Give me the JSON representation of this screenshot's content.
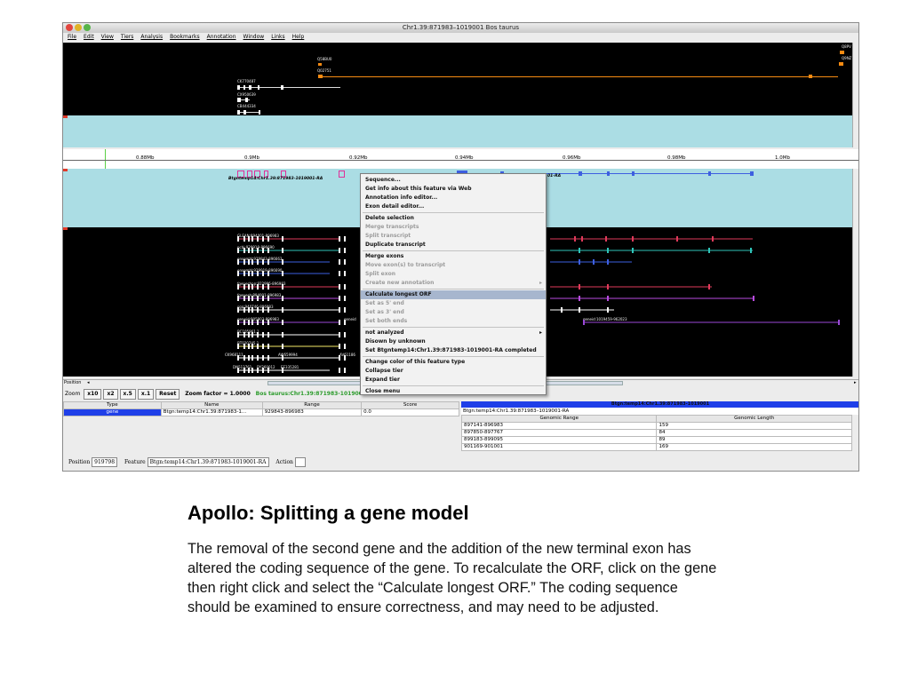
{
  "window": {
    "title": "Chr1.39:871983–1019001 Bos taurus",
    "menu": [
      "File",
      "Edit",
      "View",
      "Tiers",
      "Analysis",
      "Bookmarks",
      "Annotation",
      "Window",
      "Links",
      "Help"
    ],
    "traffic_light_colors": [
      "#e2463f",
      "#e0b327",
      "#56b448"
    ]
  },
  "overview": {
    "labels": [
      "Q58BU0",
      "Q02751",
      "CK770487",
      "CX950639",
      "CB444334",
      "Q8PV",
      "Q9NZ"
    ]
  },
  "ruler": {
    "ticks": [
      "0.88Mb",
      "0.9Mb",
      "0.92Mb",
      "0.94Mb",
      "0.96Mb",
      "0.98Mb",
      "1.0Mb"
    ]
  },
  "annotation": {
    "gene_label": "Btgntemp14:Chr1.39:871983-1019001-RA",
    "label_right": "01-RA"
  },
  "evidence": {
    "labels": [
      "GLEAN:894001-896983",
      "ncbi:929919-896690",
      "ensembl:929843-896663",
      "ensembl:929919-896690",
      "fgeneshpp:922996-896983",
      "fgenesh:894001-896983",
      "sgp:940746-896983",
      "geneid:905903-896983",
      "geneid",
      "BC105961.1",
      "BT020745.1",
      "CK968111",
      "AW659994",
      "AV61186",
      "DN513761",
      "DY260012",
      "EE335281"
    ],
    "geneid_right": "geneid:1019459-962023"
  },
  "colors": {
    "track_blue": "#3d5fe0",
    "track_red": "#e03a5a",
    "track_teal": "#2fc4b9",
    "track_violet": "#b84be0",
    "track_purple": "#9a49d6",
    "track_white": "#ffffff",
    "track_yellow": "#f3ea69",
    "orange": "#f78b12",
    "selection_blue": "#1f3fe8",
    "menu_highlight": "#a7b6ce"
  },
  "position_label": "Position",
  "zoom": {
    "label": "Zoom",
    "buttons": [
      "x10",
      "x2",
      "x.5",
      "x.1",
      "Reset"
    ],
    "factor": "Zoom factor = 1.0000",
    "region": "Bos taurus:Chr1.39:871983-101900"
  },
  "left_table": {
    "headers": [
      "Type",
      "Name",
      "Range",
      "Score"
    ],
    "row": [
      "gene",
      "Btgn:temp14:Chr1.39:871983-1...",
      "929843-896983",
      "0.0"
    ]
  },
  "right_table": {
    "title": "Btgn:temp14:Chr1.39:871983-1019001",
    "subtitle": "Btgn:temp14:Chr1.39:871983–1019001-RA",
    "headers": [
      "Genomic Range",
      "Genomic Length"
    ],
    "rows": [
      [
        "897141-896983",
        "159"
      ],
      [
        "897850-897767",
        "84"
      ],
      [
        "899183-899095",
        "89"
      ],
      [
        "901169-901001",
        "169"
      ]
    ]
  },
  "status": {
    "position_label": "Position",
    "position_value": "919798",
    "feature_label": "Feature",
    "feature_value": "Btgn:temp14:Chr1.39:871983-1019001-RA",
    "action_label": "Action"
  },
  "context_menu": {
    "items": [
      {
        "label": "Sequence...",
        "state": "enabled"
      },
      {
        "label": "Get info about this feature via Web",
        "state": "enabled"
      },
      {
        "label": "Annotation info editor...",
        "state": "enabled"
      },
      {
        "label": "Exon detail editor...",
        "state": "enabled"
      },
      {
        "label": "Delete selection",
        "state": "enabled"
      },
      {
        "label": "Merge transcripts",
        "state": "disabled"
      },
      {
        "label": "Split transcript",
        "state": "disabled"
      },
      {
        "label": "Duplicate transcript",
        "state": "enabled"
      },
      {
        "label": "Merge exons",
        "state": "enabled"
      },
      {
        "label": "Move exon(s) to transcript",
        "state": "disabled"
      },
      {
        "label": "Split exon",
        "state": "disabled"
      },
      {
        "label": "Create new annotation",
        "state": "disabled",
        "submenu": true
      },
      {
        "label": "Calculate longest ORF",
        "state": "highlighted"
      },
      {
        "label": "Set as 5' end",
        "state": "disabled"
      },
      {
        "label": "Set as 3' end",
        "state": "disabled"
      },
      {
        "label": "Set both ends",
        "state": "disabled"
      },
      {
        "label": "not analyzed",
        "state": "enabled",
        "submenu": true
      },
      {
        "label": "Disown by unknown",
        "state": "enabled"
      },
      {
        "label": "Set Btgntemp14:Chr1.39:871983-1019001-RA completed",
        "state": "enabled"
      },
      {
        "label": "Change color of this feature type",
        "state": "enabled"
      },
      {
        "label": "Collapse tier",
        "state": "enabled"
      },
      {
        "label": "Expand tier",
        "state": "enabled"
      },
      {
        "label": "Close menu",
        "state": "enabled"
      }
    ]
  },
  "slide": {
    "title": "Apollo: Splitting a gene model",
    "body": "The removal of the second gene and the addition of the new terminal exon has altered the coding sequence of the gene.  To recalculate the ORF, click on the gene then right click and select the “Calculate longest ORF.”  The coding sequence should be examined to ensure correctness, and may need to be adjusted."
  }
}
